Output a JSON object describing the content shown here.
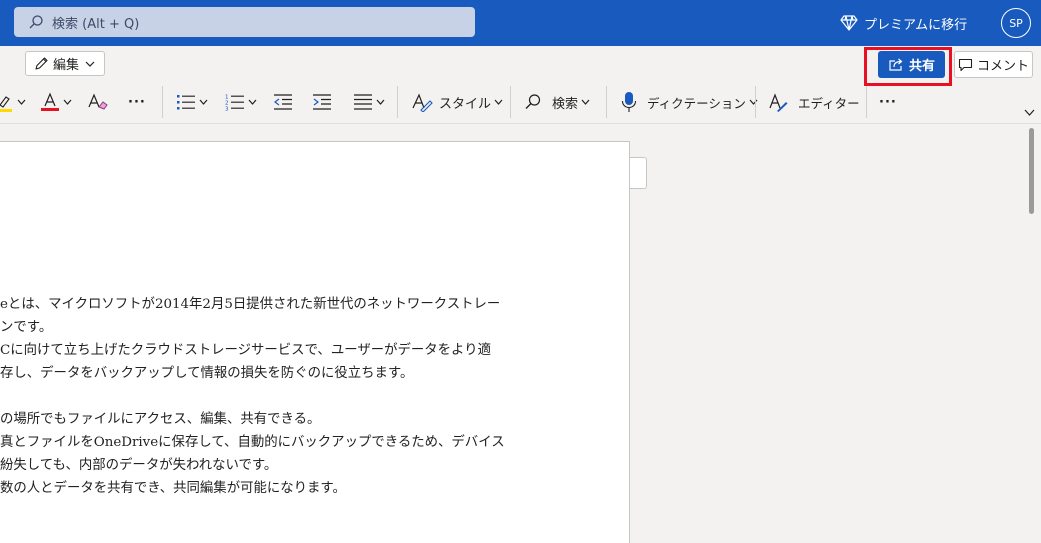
{
  "header": {
    "search_placeholder": "検索 (Alt + Q)",
    "premium_label": "プレミアムに移行",
    "avatar_initials": "SP"
  },
  "ribbon": {
    "edit_label": "編集",
    "share_label": "共有",
    "comment_label": "コメント",
    "more_label": "···",
    "style_label": "スタイル",
    "find_label": "検索",
    "dictate_label": "ディクテーション",
    "editor_label": "エディター",
    "overflow_label": "···",
    "highlight_color": "#ffd800",
    "font_color": "#e81123"
  },
  "document": {
    "lines": [
      "eとは、マイクロソフトが2014年2月5日提供された新世代のネットワークストレー",
      "ンです。",
      "Cに向けて立ち上げたクラウドストレージサービスで、ユーザーがデータをより適",
      "存し、データをバックアップして情報の損失を防ぐのに役立ちます。",
      "の場所でもファイルにアクセス、編集、共有できる。",
      "真とファイルをOneDriveに保存して、自動的にバックアップできるため、デバイス",
      "紛失しても、内部のデータが失われないです。",
      "数の人とデータを共有でき、共同編集が可能になります。"
    ]
  },
  "colors": {
    "brand": "#185abd",
    "highlight_outline": "#e81123"
  }
}
